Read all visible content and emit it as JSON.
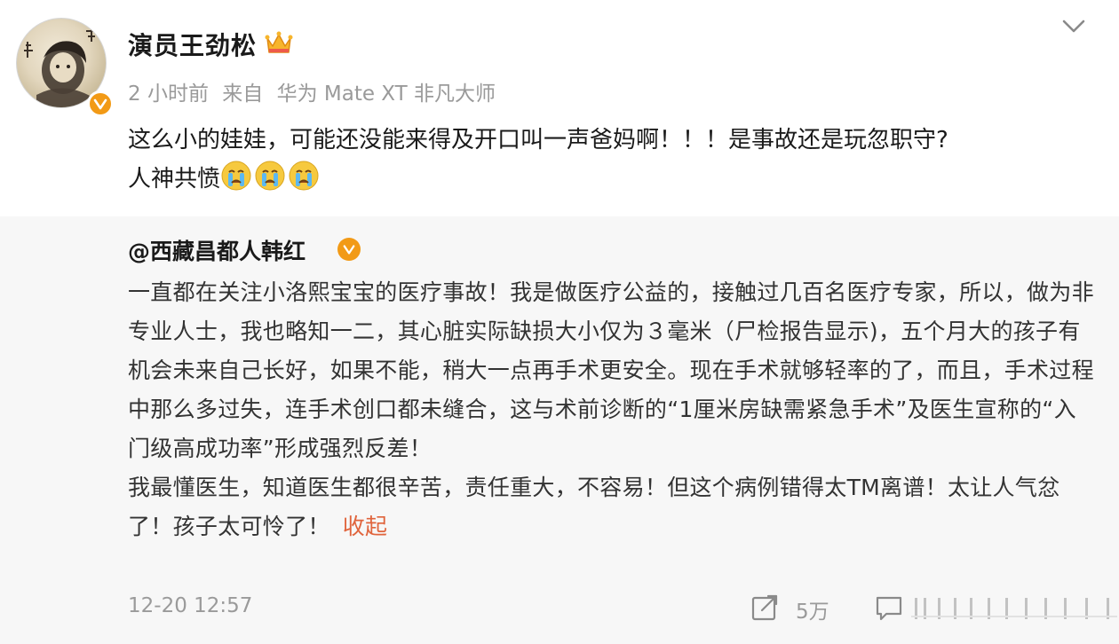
{
  "post": {
    "author": "演员王劲松",
    "time": "2 小时前",
    "source_prefix": "来自",
    "source": "华为 Mate XT 非凡大师",
    "text_line1": "这么小的娃娃，可能还没能来得及开口叫一声爸妈啊！！！是事故还是玩忽职守?",
    "text_line2": "人神共愤",
    "emojis": [
      "crying-emoji",
      "crying-emoji",
      "crying-emoji"
    ]
  },
  "retweet": {
    "author": "@西藏昌都人韩红",
    "paragraph1": "一直都在关注小洛熙宝宝的医疗事故！我是做医疗公益的，接触过几百名医疗专家，所以，做为非专业人士，我也略知一二，其心脏实际缺损大小仅为３毫米（尸检报告显示)，五个月大的孩子有机会未来自己长好，如果不能，稍大一点再手术更安全。现在手术就够轻率的了，而且，手术过程中那么多过失，连手术创口都未缝合，这与术前诊断的“1厘米房缺需紧急手术”及医生宣称的“入门级高成功率”形成强烈反差！",
    "paragraph2": "我最懂医生，知道医生都很辛苦，责任重大，不容易！但这个病例错得太TM离谱！太让人气忿了！孩子太可怜了！",
    "collapse_label": "收起",
    "timestamp": "12-20 12:57",
    "share_count": "5万"
  },
  "colors": {
    "badge": "#f29a16",
    "link": "#e0643c",
    "meta": "#9a9a9a",
    "retweet_bg": "#f7f7f7"
  },
  "icons": [
    "crown-icon",
    "verified-icon",
    "chevron-down-icon",
    "share-icon",
    "comment-icon"
  ]
}
